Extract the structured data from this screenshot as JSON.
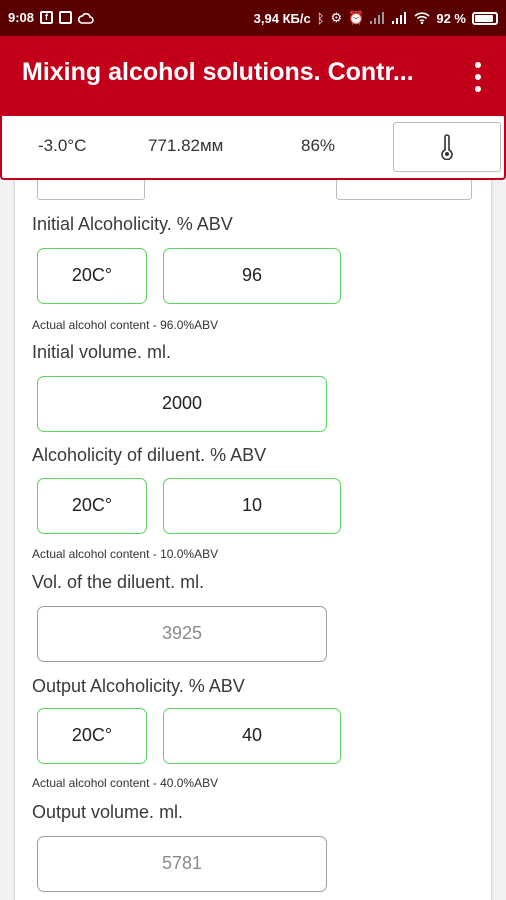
{
  "status": {
    "time": "9:08",
    "speed": "3,94 КБ/с",
    "battery_pct": "92 %",
    "battery_level": 0.92
  },
  "app": {
    "title": "Mixing alcohol solutions. Contr..."
  },
  "weather": {
    "temperature": "-3.0°C",
    "pressure": "771.82мм",
    "humidity": "86%"
  },
  "form": {
    "initial_alc": {
      "label": "Initial Alcoholicity. % ABV",
      "temp": "20C°",
      "value": "96",
      "note": "Actual alcohol content - 96.0%ABV"
    },
    "initial_vol": {
      "label": "Initial volume. ml.",
      "value": "2000"
    },
    "diluent_alc": {
      "label": "Alcoholicity of diluent. % ABV",
      "temp": "20C°",
      "value": "10",
      "note": "Actual alcohol content - 10.0%ABV"
    },
    "diluent_vol": {
      "label": "Vol. of the diluent. ml.",
      "value": "3925"
    },
    "output_alc": {
      "label": "Output  Alcoholicity. % ABV",
      "temp": "20C°",
      "value": "40",
      "note": "Actual alcohol content - 40.0%ABV"
    },
    "output_vol": {
      "label": "Output volume. ml.",
      "value": "5781"
    }
  }
}
